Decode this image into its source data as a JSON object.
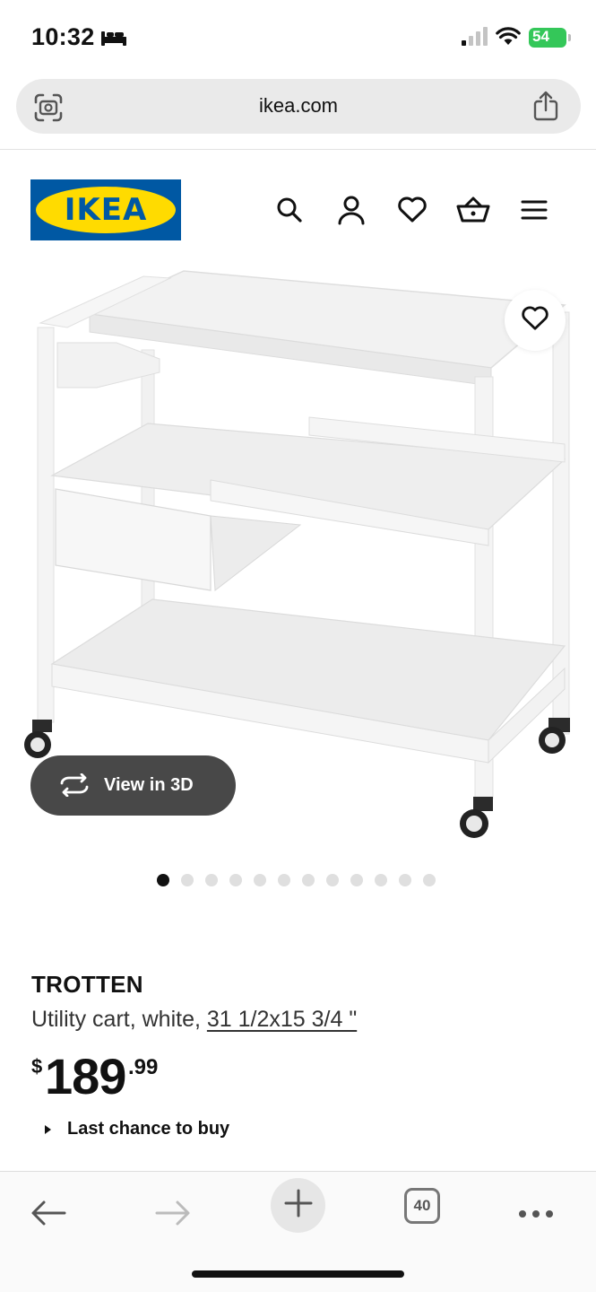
{
  "status_bar": {
    "time": "10:32",
    "battery": "54"
  },
  "browser": {
    "url": "ikea.com",
    "tabs_count": "40"
  },
  "site": {
    "logo_text": "IKEA",
    "brand_colors": {
      "blue": "#0058a3",
      "yellow": "#ffdb00"
    },
    "header_icons": [
      "search-icon",
      "account-icon",
      "wishlist-icon",
      "cart-icon",
      "menu-icon"
    ]
  },
  "product": {
    "name": "TROTTEN",
    "description": "Utility cart, white, ",
    "size": "31 1/2x15 3/4 \"",
    "price": {
      "currency": "$",
      "integer": "189",
      "decimal": ".99"
    },
    "view3d_label": "View in 3D",
    "availability": "Last chance to buy",
    "image_count": 12,
    "active_image": 1
  }
}
